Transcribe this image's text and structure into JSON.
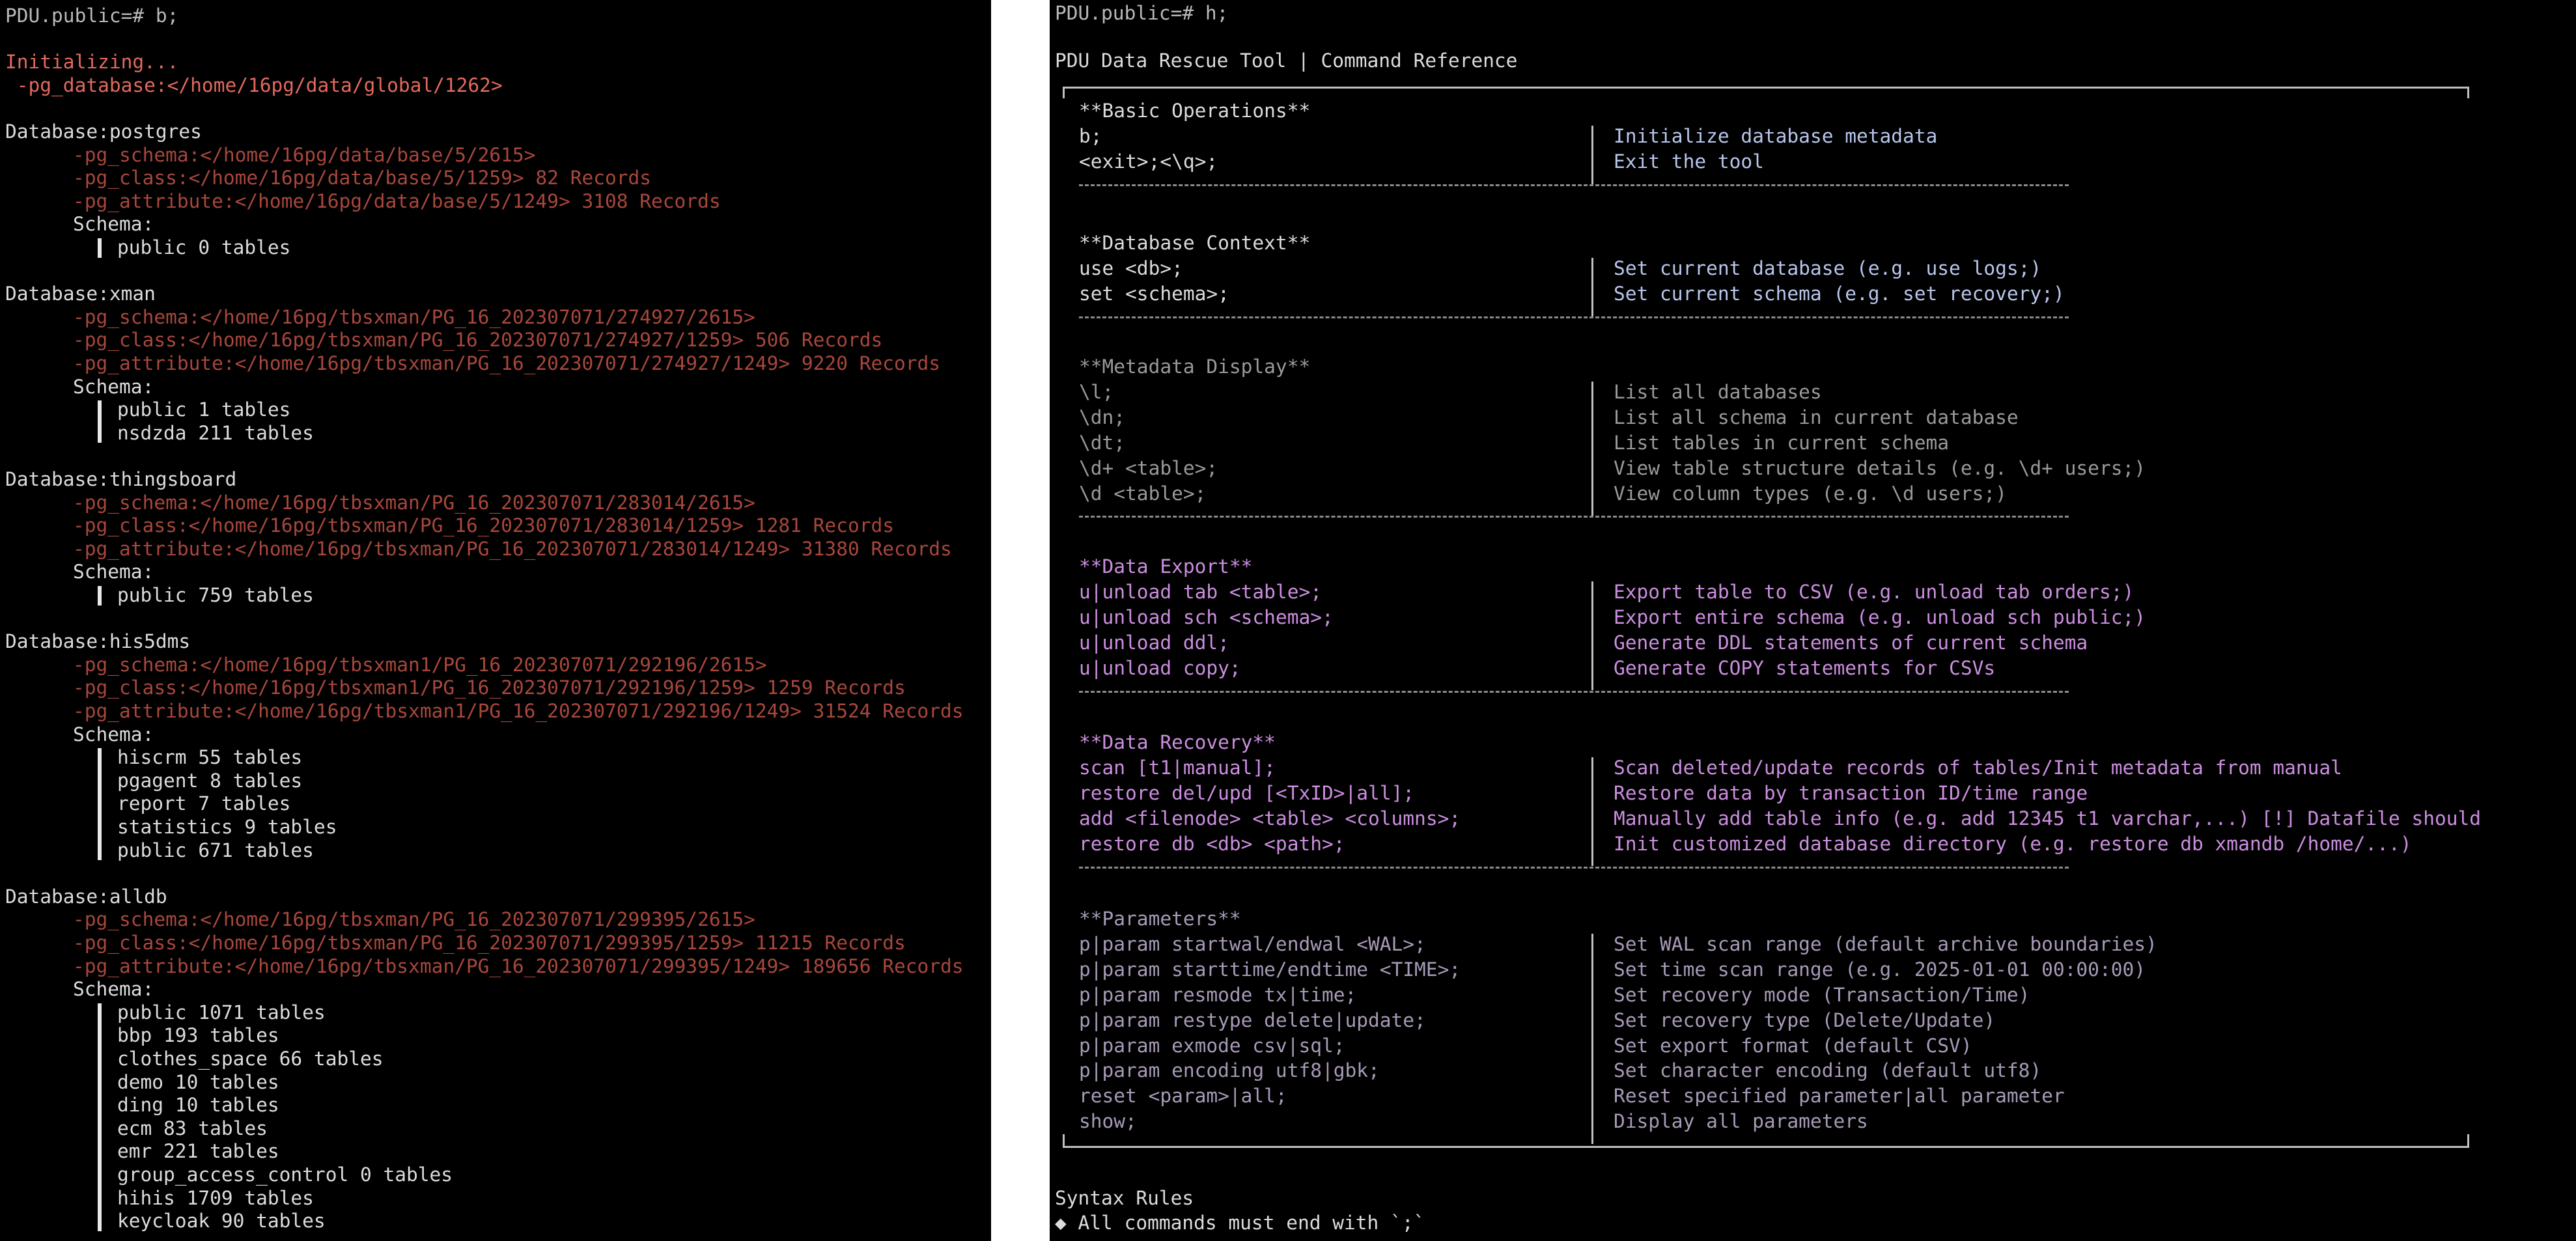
{
  "colors": {
    "background": "#000000",
    "prompt": "#b9b9b9",
    "text": "#dcdcdc",
    "error_red": "#e26a5e",
    "path_red": "#a8473c",
    "blue": "#b8c6ec",
    "purple": "#cc8ee0",
    "muted_purple": "#a79ab7",
    "dim_gray": "#9a9a9a"
  },
  "left_terminal": {
    "prompt": "PDU.public=# b;",
    "init_line": "Initializing...",
    "init_db_line": " -pg_database:</home/16pg/data/global/1262>",
    "schema_label": "Schema:",
    "databases": [
      {
        "header": "Database:postgres",
        "schema_path": "-pg_schema:</home/16pg/data/base/5/2615>",
        "class_path": "-pg_class:</home/16pg/data/base/5/1259> 82 Records",
        "attr_path": "-pg_attribute:</home/16pg/data/base/5/1249> 3108 Records",
        "schemas": [
          "public 0 tables"
        ]
      },
      {
        "header": "Database:xman",
        "schema_path": "-pg_schema:</home/16pg/tbsxman/PG_16_202307071/274927/2615>",
        "class_path": "-pg_class:</home/16pg/tbsxman/PG_16_202307071/274927/1259> 506 Records",
        "attr_path": "-pg_attribute:</home/16pg/tbsxman/PG_16_202307071/274927/1249> 9220 Records",
        "schemas": [
          "public 1 tables",
          "nsdzda 211 tables"
        ]
      },
      {
        "header": "Database:thingsboard",
        "schema_path": "-pg_schema:</home/16pg/tbsxman/PG_16_202307071/283014/2615>",
        "class_path": "-pg_class:</home/16pg/tbsxman/PG_16_202307071/283014/1259> 1281 Records",
        "attr_path": "-pg_attribute:</home/16pg/tbsxman/PG_16_202307071/283014/1249> 31380 Records",
        "schemas": [
          "public 759 tables"
        ]
      },
      {
        "header": "Database:his5dms",
        "schema_path": "-pg_schema:</home/16pg/tbsxman1/PG_16_202307071/292196/2615>",
        "class_path": "-pg_class:</home/16pg/tbsxman1/PG_16_202307071/292196/1259> 1259 Records",
        "attr_path": "-pg_attribute:</home/16pg/tbsxman1/PG_16_202307071/292196/1249> 31524 Records",
        "schemas": [
          "hiscrm 55 tables",
          "pgagent 8 tables",
          "report 7 tables",
          "statistics 9 tables",
          "public 671 tables"
        ]
      },
      {
        "header": "Database:alldb",
        "schema_path": "-pg_schema:</home/16pg/tbsxman/PG_16_202307071/299395/2615>",
        "class_path": "-pg_class:</home/16pg/tbsxman/PG_16_202307071/299395/1259> 11215 Records",
        "attr_path": "-pg_attribute:</home/16pg/tbsxman/PG_16_202307071/299395/1249> 189656 Records",
        "schemas": [
          "public 1071 tables",
          "bbp 193 tables",
          "clothes_space 66 tables",
          "demo 10 tables",
          "ding 10 tables",
          "ecm 83 tables",
          "emr 221 tables",
          "group_access_control 0 tables",
          "hihis 1709 tables",
          "keycloak 90 tables"
        ]
      }
    ]
  },
  "right_terminal": {
    "prompt": "PDU.public=# h;",
    "title": "PDU Data Rescue Tool | Command Reference",
    "sections": [
      {
        "heading": "**Basic Operations**",
        "rows": [
          {
            "cmd": "b;",
            "desc": "Initialize database metadata"
          },
          {
            "cmd": "<exit>;<\\q>;",
            "desc": "Exit the tool"
          }
        ]
      },
      {
        "heading": "**Database Context**",
        "rows": [
          {
            "cmd": "use <db>;",
            "desc": "Set current database (e.g. use logs;)"
          },
          {
            "cmd": "set <schema>;",
            "desc": "Set current schema (e.g. set recovery;)"
          }
        ]
      },
      {
        "heading": "**Metadata Display**",
        "rows": [
          {
            "cmd": "\\l;",
            "desc": "List all databases"
          },
          {
            "cmd": "\\dn;",
            "desc": "List all schema in current database"
          },
          {
            "cmd": "\\dt;",
            "desc": "List tables in current schema"
          },
          {
            "cmd": "\\d+ <table>;",
            "desc": "View table structure details (e.g. \\d+ users;)"
          },
          {
            "cmd": "\\d <table>;",
            "desc": "View column types (e.g. \\d users;)"
          }
        ]
      },
      {
        "heading": "**Data Export**",
        "rows": [
          {
            "cmd": "u|unload tab <table>;",
            "desc": "Export table to CSV (e.g. unload tab orders;)"
          },
          {
            "cmd": "u|unload sch <schema>;",
            "desc": "Export entire schema (e.g. unload sch public;)"
          },
          {
            "cmd": "u|unload ddl;",
            "desc": "Generate DDL statements of current schema"
          },
          {
            "cmd": "u|unload copy;",
            "desc": "Generate COPY statements for CSVs"
          }
        ]
      },
      {
        "heading": "**Data Recovery**",
        "rows": [
          {
            "cmd": "scan [t1|manual];",
            "desc": "Scan deleted/update records of tables/Init metadata from manual"
          },
          {
            "cmd": "restore del/upd [<TxID>|all];",
            "desc": "Restore data by transaction ID/time range"
          },
          {
            "cmd": "add <filenode> <table> <columns>;",
            "desc": "Manually add table info (e.g. add 12345 t1 varchar,...) [!] Datafile should"
          },
          {
            "cmd": "restore db <db> <path>;",
            "desc": "Init customized database directory (e.g. restore db xmandb /home/...)"
          }
        ]
      },
      {
        "heading": "**Parameters**",
        "rows": [
          {
            "cmd": "p|param startwal/endwal <WAL>;",
            "desc": "Set WAL scan range (default archive boundaries)"
          },
          {
            "cmd": "p|param starttime/endtime <TIME>;",
            "desc": "Set time scan range (e.g. 2025-01-01 00:00:00)"
          },
          {
            "cmd": "p|param resmode tx|time;",
            "desc": "Set recovery mode (Transaction/Time)"
          },
          {
            "cmd": "p|param restype delete|update;",
            "desc": "Set recovery type (Delete/Update)"
          },
          {
            "cmd": "p|param exmode csv|sql;",
            "desc": "Set export format (default CSV)"
          },
          {
            "cmd": "p|param encoding utf8|gbk;",
            "desc": "Set character encoding (default utf8)"
          },
          {
            "cmd": "reset <param>|all;",
            "desc": "Reset specified parameter|all parameter"
          },
          {
            "cmd": "show;",
            "desc": "Display all parameters"
          }
        ]
      }
    ],
    "syntax_title": "Syntax Rules",
    "syntax_rule": "◆ All commands must end with `;`"
  }
}
